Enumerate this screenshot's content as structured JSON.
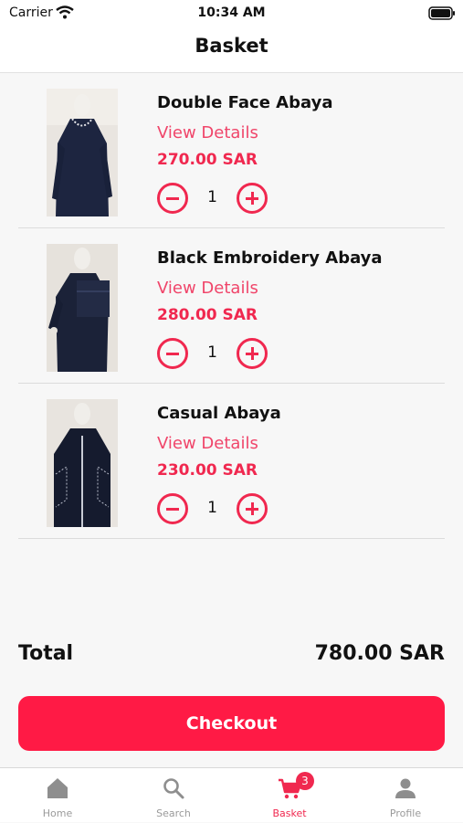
{
  "status_bar": {
    "carrier": "Carrier",
    "time": "10:34 AM"
  },
  "header": {
    "title": "Basket"
  },
  "items": [
    {
      "name": "Double Face Abaya",
      "details_label": "View Details",
      "price": "270.00 SAR",
      "quantity": "1",
      "image": "product-photo"
    },
    {
      "name": "Black Embroidery Abaya",
      "details_label": "View Details",
      "price": "280.00 SAR",
      "quantity": "1",
      "image": "product-photo"
    },
    {
      "name": "Casual Abaya",
      "details_label": "View Details",
      "price": "230.00 SAR",
      "quantity": "1",
      "image": "product-photo"
    }
  ],
  "summary": {
    "total_label": "Total",
    "total_value": "780.00 SAR"
  },
  "checkout": {
    "label": "Checkout"
  },
  "tabs": [
    {
      "label": "Home",
      "icon": "home-icon",
      "active": false
    },
    {
      "label": "Search",
      "icon": "search-icon",
      "active": false
    },
    {
      "label": "Basket",
      "icon": "cart-icon",
      "active": true,
      "badge": "3"
    },
    {
      "label": "Profile",
      "icon": "profile-icon",
      "active": false
    }
  ],
  "colors": {
    "accent": "#f0284f",
    "checkout": "#ff1a45",
    "inactive": "#9a9a9a"
  }
}
